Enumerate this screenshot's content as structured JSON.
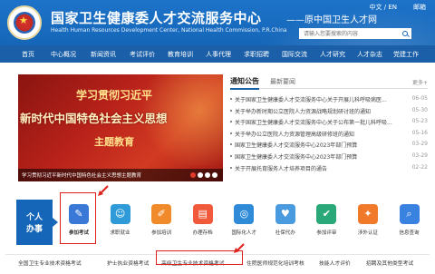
{
  "header": {
    "title": "国家卫生健康委人才交流服务中心",
    "subtitle_en": "Health Human Resources Development Center, National Health Commission, P.R.China",
    "slogan": "——原中国卫生人才网",
    "lang_switch": "中文 / EN",
    "mailbox": "邮箱",
    "search_placeholder": "请输入您要搜索的内容"
  },
  "nav": {
    "items": [
      "首页",
      "中心概况",
      "新闻资讯",
      "考试评价",
      "教育培训",
      "人事代理",
      "求职招聘",
      "国际交流",
      "人才研究",
      "人才杂志",
      "党建工作"
    ]
  },
  "banner": {
    "line1": "学习贯彻习近平",
    "line2": "新时代中国特色社会主义思想",
    "line3": "主题教育",
    "caption": "学习贯彻习近平新时代中国特色社会主义思想主题教育"
  },
  "notices": {
    "tab_notice": "通知公告",
    "tab_news": "最新要闻",
    "more": "更多+",
    "items": [
      {
        "title": "关于国家卫生健康委人才交流服务中心关于开展儿科呼吸病医...",
        "date": "06-05"
      },
      {
        "title": "关于举办新时期公立医院人力资源战略规划研讨班的通知",
        "date": "05-30"
      },
      {
        "title": "关于国家卫生健康委人才交流服务中心关于公布第一批儿科呼吸...",
        "date": "05-23"
      },
      {
        "title": "关于举办公立医院人力资源管理高级研修班的通知",
        "date": "05-16"
      },
      {
        "title": "国家卫生健康委人才交流服务中心2023年部门预算",
        "date": "03-29"
      },
      {
        "title": "国家卫生健康委人才交流服务中心2023年部门预算",
        "date": "03-29"
      },
      {
        "title": "关于开展托育服务人才培养项目的通告",
        "date": "02-22"
      }
    ]
  },
  "services": {
    "personal_line1": "个人",
    "personal_line2": "办事",
    "items": [
      {
        "label": "参加考试",
        "icon": "exam-icon",
        "color": "#3a78d8"
      },
      {
        "label": "求职就业",
        "icon": "job-icon",
        "color": "#2f9ad8"
      },
      {
        "label": "参加培训",
        "icon": "training-icon",
        "color": "#f08a2a"
      },
      {
        "label": "办理存档",
        "icon": "archive-icon",
        "color": "#f05a3a"
      },
      {
        "label": "国际化人才",
        "icon": "global-icon",
        "color": "#2f8ad8"
      },
      {
        "label": "社保代办",
        "icon": "social-icon",
        "color": "#4a9ae0"
      },
      {
        "label": "参加评审",
        "icon": "review-icon",
        "color": "#2aa87a"
      },
      {
        "label": "涉外认证",
        "icon": "cert-icon",
        "color": "#f07a2a"
      },
      {
        "label": "信息查询",
        "icon": "query-icon",
        "color": "#3a82e0"
      }
    ]
  },
  "exam_tabs": {
    "items": [
      "全国卫生专业技术资格考试",
      "护士执业资格考试",
      "高级卫生专业技术资格考试",
      "住院医师规范化培训考核",
      "技能人才评价",
      "招聘及其他类型考试"
    ]
  },
  "colors": {
    "header_blue": "#1566b8",
    "nav_blue": "#1a5fa8",
    "highlight_red": "#e0201a"
  }
}
